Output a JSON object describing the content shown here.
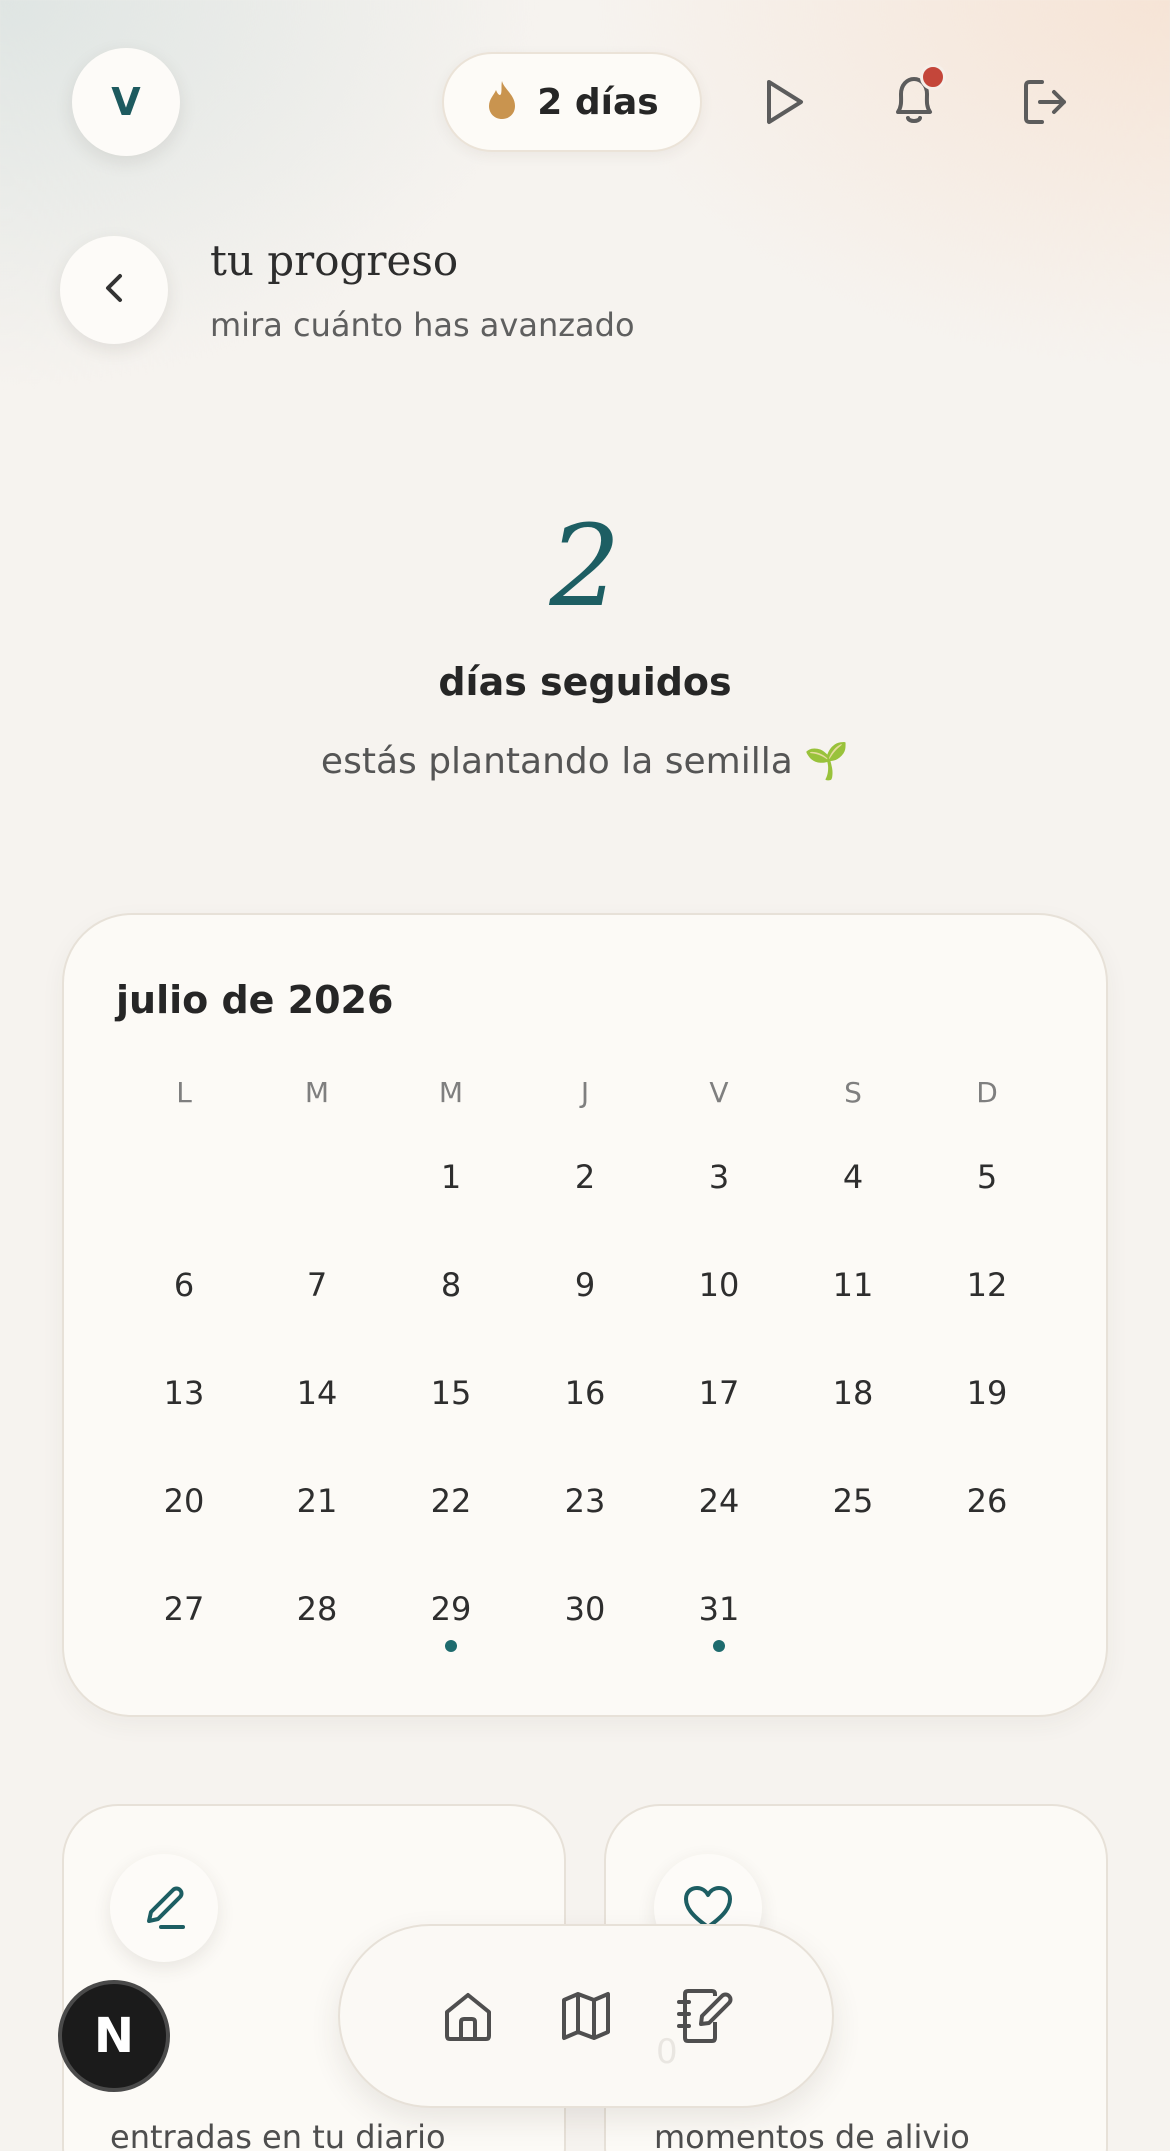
{
  "user": {
    "avatar_initial": "V"
  },
  "topbar": {
    "streak_label": "2 días",
    "icons": [
      "flame-icon",
      "play-icon",
      "bell-icon",
      "logout-icon"
    ],
    "notification_badge_color": "#c4463a"
  },
  "header": {
    "title": "tu progreso",
    "subtitle": "mira cuánto has avanzado"
  },
  "streak": {
    "count": "2",
    "label": "días seguidos",
    "message": "estás plantando la semilla 🌱"
  },
  "calendar": {
    "month": "julio de 2026",
    "weekdays": [
      "L",
      "M",
      "M",
      "J",
      "V",
      "S",
      "D"
    ],
    "first_weekday_index": 2,
    "days": [
      "1",
      "2",
      "3",
      "4",
      "5",
      "6",
      "7",
      "8",
      "9",
      "10",
      "11",
      "12",
      "13",
      "14",
      "15",
      "16",
      "17",
      "18",
      "19",
      "20",
      "21",
      "22",
      "23",
      "24",
      "25",
      "26",
      "27",
      "28",
      "29",
      "30",
      "31"
    ],
    "marked_days": [
      "29",
      "31"
    ],
    "marker_color": "#1e6b6e"
  },
  "stats": [
    {
      "icon": "pencil-icon",
      "label": "entradas en tu diario"
    },
    {
      "icon": "heart-icon",
      "label": "momentos de alivio"
    }
  ],
  "bottom_nav": {
    "items": [
      {
        "icon": "home-icon"
      },
      {
        "icon": "map-icon"
      },
      {
        "icon": "journal-icon"
      }
    ],
    "faint_value": "0"
  },
  "dev_badge": {
    "label": "N"
  },
  "colors": {
    "accent_teal": "#1d5e63",
    "flame": "#c9944f",
    "background": "#f6f3ef"
  }
}
